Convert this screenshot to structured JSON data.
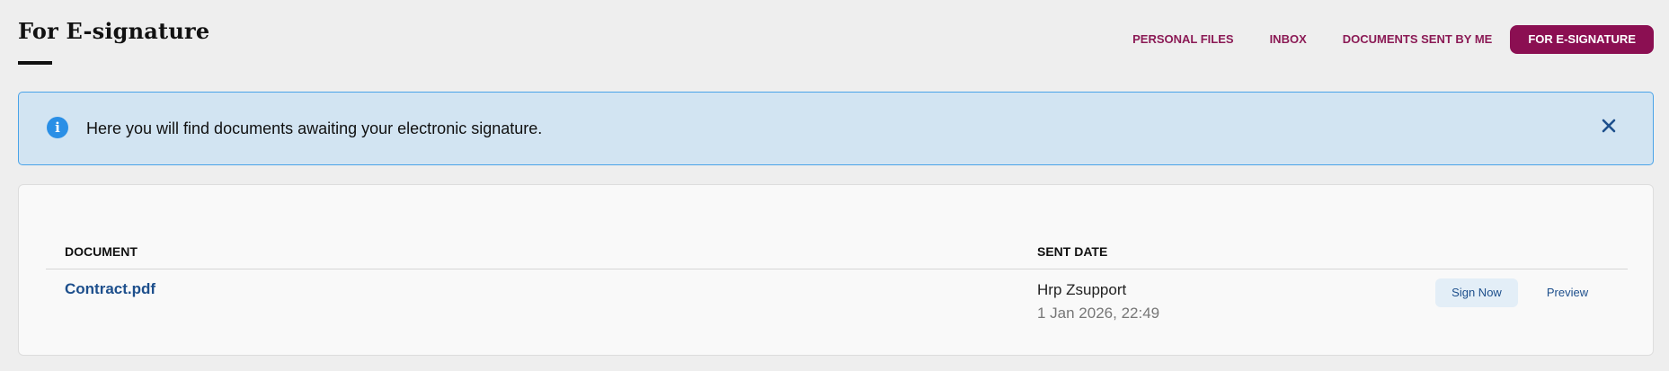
{
  "header": {
    "title": "For E-signature"
  },
  "nav": {
    "items": [
      {
        "label": "PERSONAL FILES",
        "active": false
      },
      {
        "label": "INBOX",
        "active": false
      },
      {
        "label": "DOCUMENTS SENT BY ME",
        "active": false
      },
      {
        "label": "FOR E-SIGNATURE",
        "active": true
      }
    ]
  },
  "banner": {
    "icon": "info-icon",
    "text": "Here you will find documents awaiting your electronic signature.",
    "close_icon": "close-icon"
  },
  "table": {
    "columns": [
      "DOCUMENT",
      "SENT DATE"
    ],
    "rows": [
      {
        "document": "Contract.pdf",
        "sender": "Hrp Zsupport",
        "sent_date": "1 Jan 2026, 22:49",
        "actions": {
          "sign": "Sign Now",
          "preview": "Preview"
        }
      }
    ]
  },
  "colors": {
    "accent": "#8b0f52",
    "link": "#1d4f8c",
    "banner_bg": "#d2e4f2",
    "banner_border": "#4aa3e8",
    "info_icon": "#2a8fe6"
  }
}
